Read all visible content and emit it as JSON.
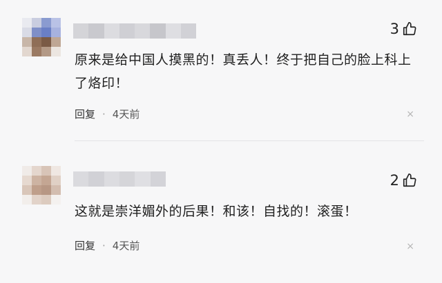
{
  "comments": [
    {
      "like_count": "3",
      "text": "原来是给中国人摸黑的！真丢人！终于把自己的脸上科上了烙印！",
      "reply_label": "回复",
      "separator": "·",
      "time": "4天前",
      "close_glyph": "×"
    },
    {
      "like_count": "2",
      "text": "这就是崇洋媚外的后果！和该！自找的！滚蛋！",
      "reply_label": "回复",
      "separator": "·",
      "time": "4天前",
      "close_glyph": "×"
    }
  ],
  "icons": {
    "like": "thumbs-up-icon",
    "close": "close-icon"
  },
  "colors": {
    "background": "#f7f7f8",
    "text": "#1f1f1f",
    "meta": "#555555",
    "close": "#b5b5b5"
  }
}
